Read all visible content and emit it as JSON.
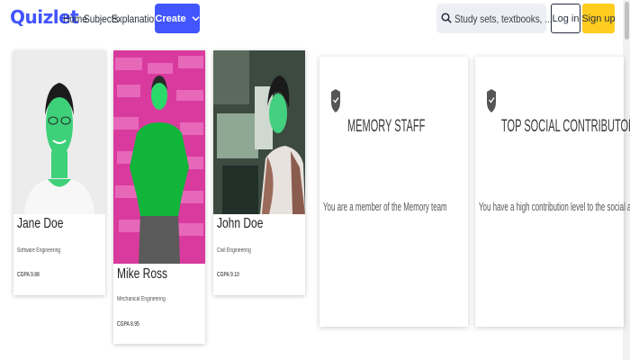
{
  "header": {
    "logo": "Quizlet",
    "nav": [
      "Home",
      "Subjects",
      "Explanations"
    ],
    "create_label": "Create",
    "search_placeholder": "Study sets, textbooks, ...",
    "login_label": "Log in",
    "signup_label": "Sign up",
    "accent_color": "#4255ff",
    "signup_color": "#ffcd1f"
  },
  "profiles": [
    {
      "name": "Jane Doe",
      "department": "Software Engineering",
      "cgpa": "CGPA 9.88",
      "photo_tint": "#2ecc71"
    },
    {
      "name": "Mike Ross",
      "department": "Mechanical Engineering",
      "cgpa": "CGPA 8.95",
      "photo_tint": "#00c853",
      "background_tint": "#e0219a"
    },
    {
      "name": "John Doe",
      "department": "Civil Engineering",
      "cgpa": "CGPA 9.10",
      "photo_tint": "#2ecc71"
    }
  ],
  "badges": [
    {
      "icon": "shield-icon",
      "title": "MEMORY STAFF",
      "description": "You are a member of the Memory team"
    },
    {
      "icon": "shield-icon",
      "title": "TOP SOCIAL CONTRIBUTOR",
      "description": "You have a high contribution level to the social aspects"
    }
  ]
}
